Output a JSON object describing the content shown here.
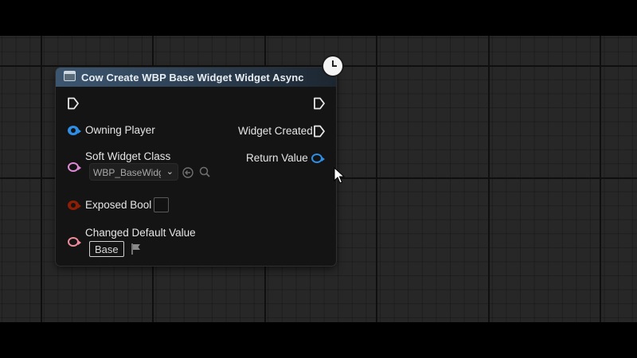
{
  "node": {
    "title": "Cow Create WBP Base Widget Widget Async",
    "inputs": {
      "owning_player": "Owning Player",
      "soft_widget_class": "Soft Widget Class",
      "soft_widget_class_value": "WBP_BaseWidg",
      "exposed_bool": "Exposed Bool",
      "changed_default_value": "Changed Default Value",
      "changed_default_value_value": "Base"
    },
    "outputs": {
      "widget_created": "Widget Created",
      "return_value": "Return Value"
    }
  },
  "icons": {
    "header": "function-node-icon",
    "latent": "clock-icon",
    "browse": "use-selected-asset-icon",
    "search": "search-icon",
    "flag": "flag-icon",
    "cursor": "mouse-cursor-icon"
  },
  "colors": {
    "header_start": "#3c5670",
    "object_pin": "#2f8ee6",
    "soft_class_pin": "#e08ad6",
    "bool_pin": "#8c1f05",
    "struct_pin": "#f08a9a",
    "node_body": "#141414",
    "graph_bg": "#272727"
  }
}
